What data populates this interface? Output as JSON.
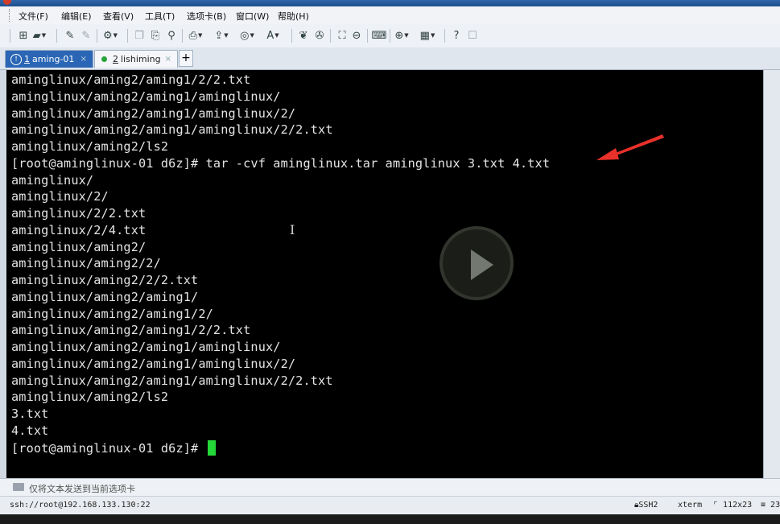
{
  "menu": {
    "items": [
      "文件(F)",
      "编辑(E)",
      "查看(V)",
      "工具(T)",
      "选项卡(B)",
      "窗口(W)",
      "帮助(H)"
    ]
  },
  "tabs": [
    {
      "number": "1",
      "label": "aming-01",
      "active": true,
      "status": "info"
    },
    {
      "number": "2",
      "label": "lishiming",
      "active": false,
      "status": "connected"
    }
  ],
  "new_tab_label": "+",
  "terminal": {
    "lines": [
      "aminglinux/aming2/aming1/2/2.txt",
      "aminglinux/aming2/aming1/aminglinux/",
      "aminglinux/aming2/aming1/aminglinux/2/",
      "aminglinux/aming2/aming1/aminglinux/2/2.txt",
      "aminglinux/aming2/ls2",
      "[root@aminglinux-01 d6z]# tar -cvf aminglinux.tar aminglinux 3.txt 4.txt",
      "aminglinux/",
      "aminglinux/2/",
      "aminglinux/2/2.txt",
      "aminglinux/2/4.txt",
      "aminglinux/aming2/",
      "aminglinux/aming2/2/",
      "aminglinux/aming2/2/2.txt",
      "aminglinux/aming2/aming1/",
      "aminglinux/aming2/aming1/2/",
      "aminglinux/aming2/aming1/2/2.txt",
      "aminglinux/aming2/aming1/aminglinux/",
      "aminglinux/aming2/aming1/aminglinux/2/",
      "aminglinux/aming2/aming1/aminglinux/2/2.txt",
      "aminglinux/aming2/ls2",
      "3.txt",
      "4.txt"
    ],
    "prompt": "[root@aminglinux-01 d6z]# ",
    "cursor_color": "#25d83a"
  },
  "send_bar": {
    "text": "仅将文本发送到当前选项卡",
    "icon": "keyboard-icon"
  },
  "status": {
    "connection": "ssh://root@192.168.133.130:22",
    "protocol": "SSH2",
    "terminal_type": "xterm",
    "size": "112x23",
    "position": "23"
  },
  "colors": {
    "terminal_bg": "#000000",
    "terminal_fg": "#e4e4e4",
    "active_tab": "#2a66b5",
    "annotation_arrow": "#e8312a"
  }
}
